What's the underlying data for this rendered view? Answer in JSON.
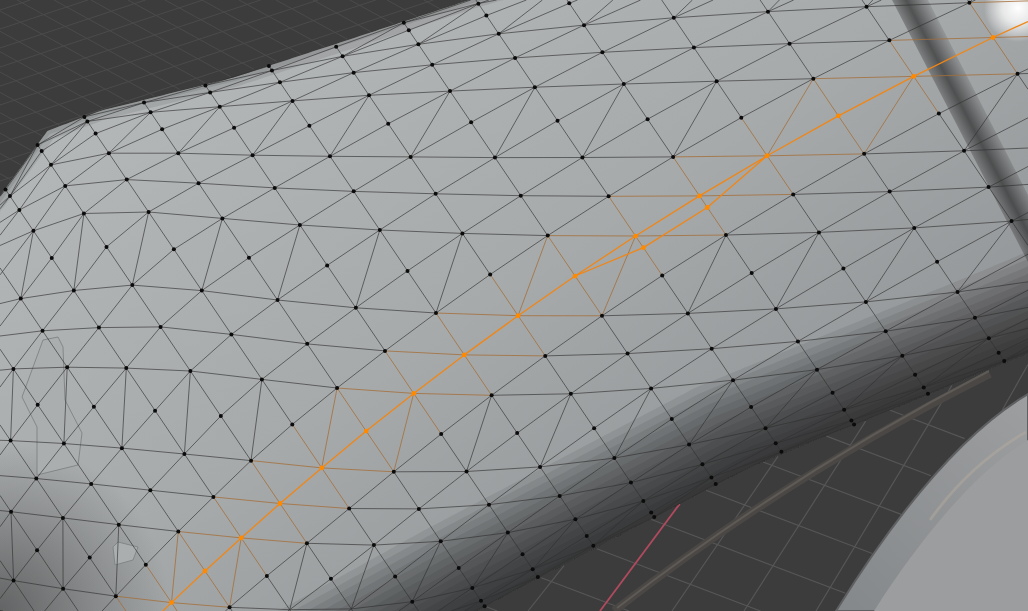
{
  "viewport": {
    "mesh": {
      "edge_loop": {
        "selected": true
      }
    }
  }
}
